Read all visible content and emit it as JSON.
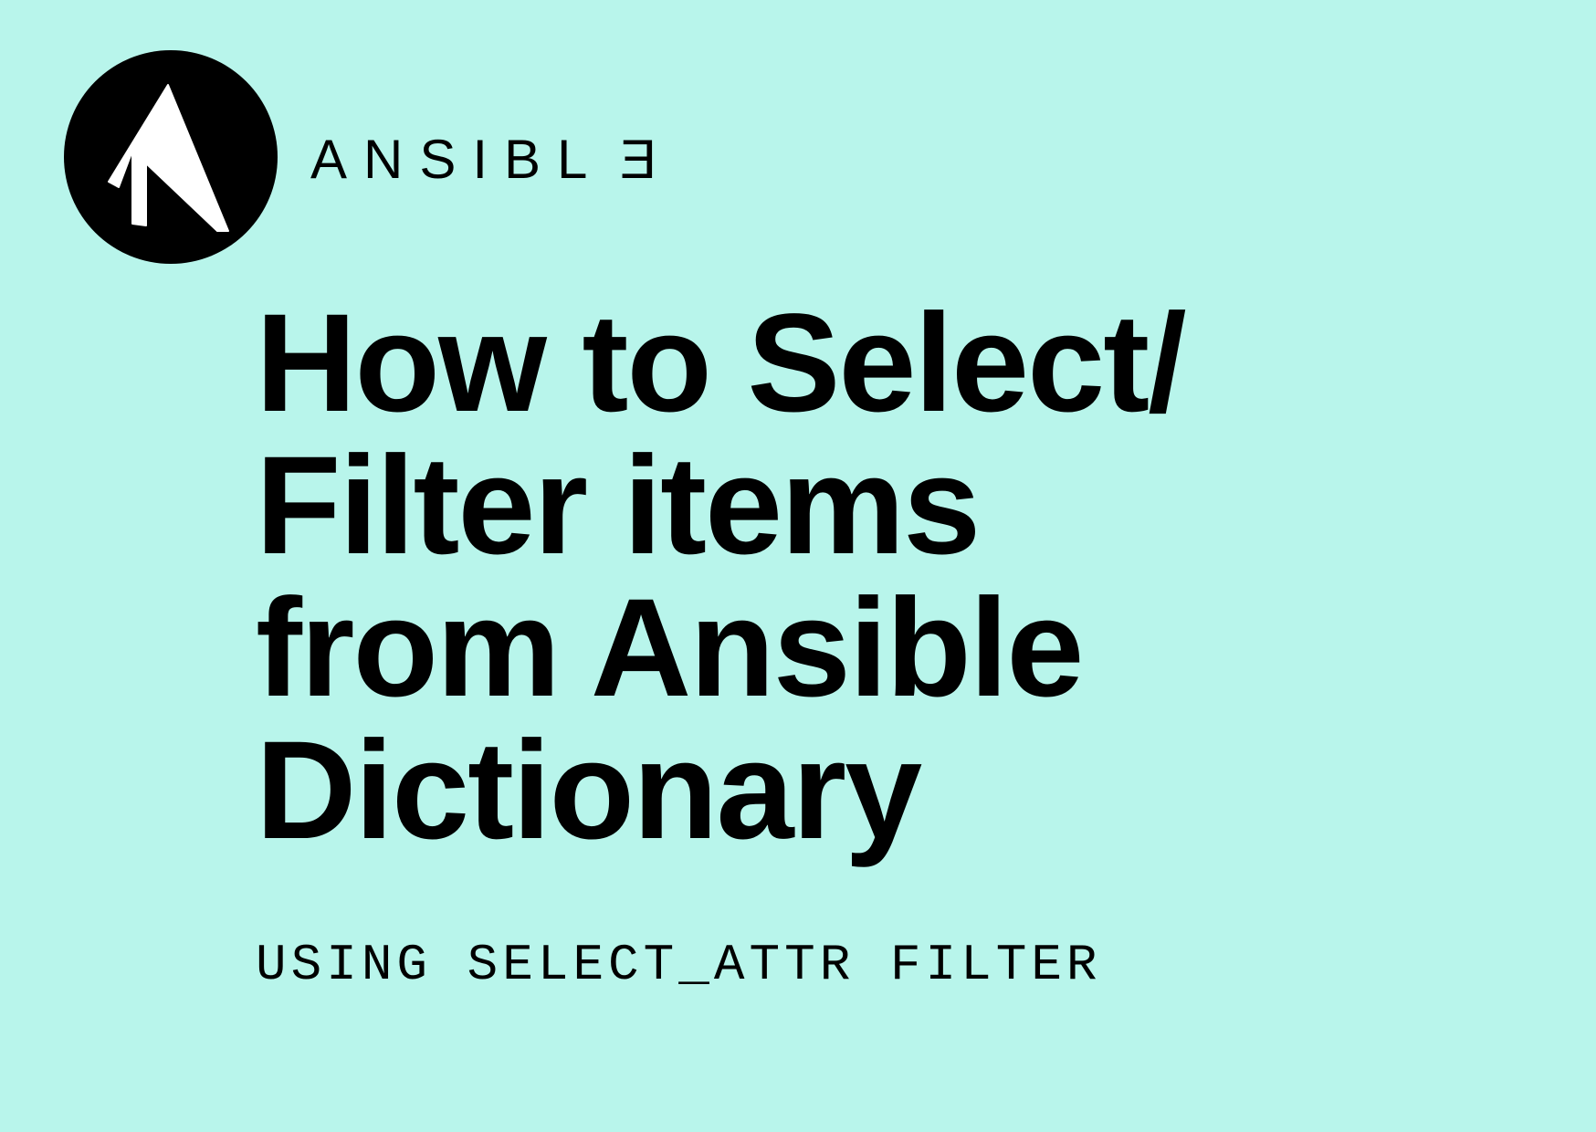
{
  "brand": {
    "name": "ANSIBLE",
    "logo_letter": "A"
  },
  "title": "How to Select/\nFilter items\nfrom Ansible\nDictionary",
  "subtitle": "USING SELECT_ATTR FILTER"
}
